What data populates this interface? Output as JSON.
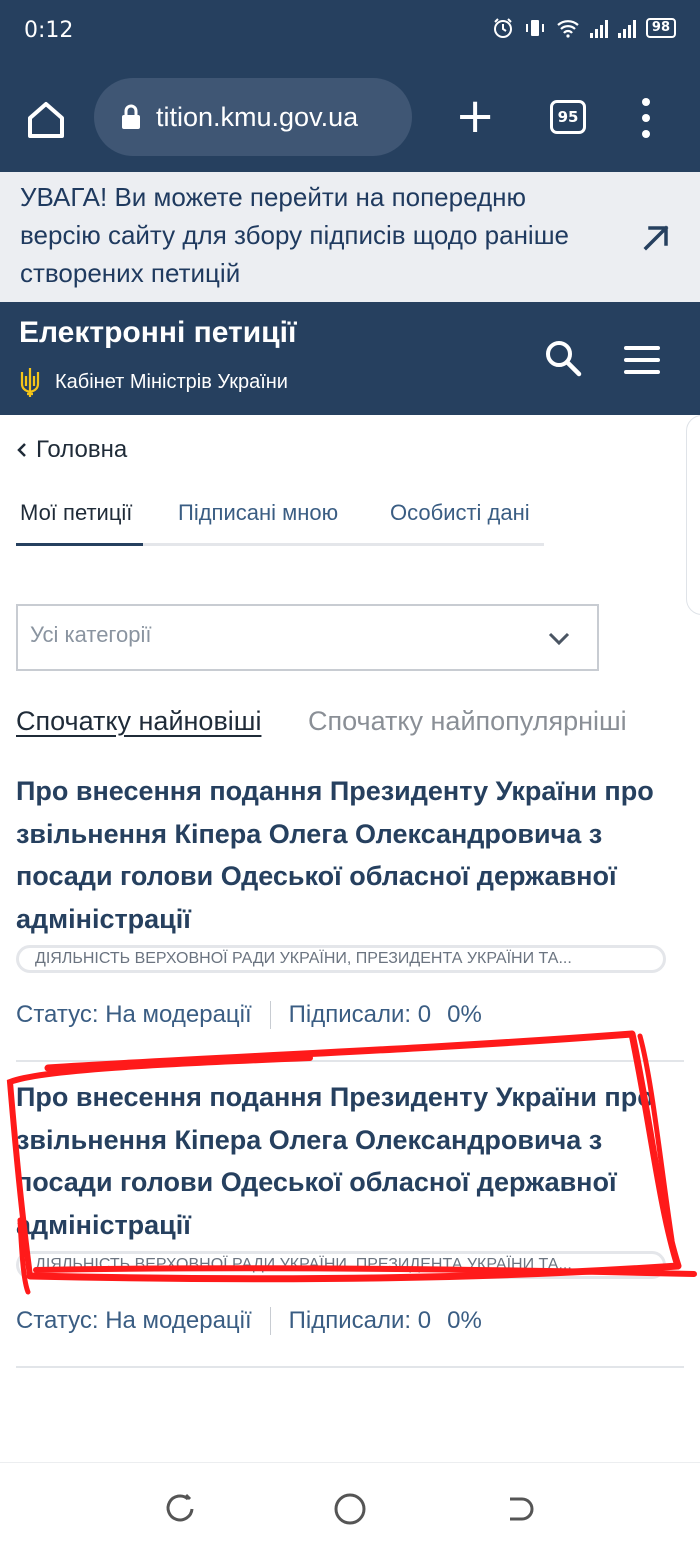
{
  "status_bar": {
    "time": "0:12",
    "battery": "98"
  },
  "browser": {
    "url": "tition.kmu.gov.ua",
    "tab_count": "95"
  },
  "notice": {
    "text": "УВАГА! Ви можете перейти на попередню версію сайту для збору підписів щодо раніше створених петицій"
  },
  "site_header": {
    "title": "Електронні петиції",
    "subtitle": "Кабінет Міністрів України"
  },
  "breadcrumb": {
    "label": "Головна"
  },
  "tabs": [
    {
      "label": "Мої петиції",
      "active": true
    },
    {
      "label": "Підписані мною",
      "active": false
    },
    {
      "label": "Особисті дані",
      "active": false
    }
  ],
  "filter": {
    "category_value": "Усі категорії"
  },
  "sort": {
    "newest": "Спочатку найновіші",
    "popular": "Спочатку найпопулярніші"
  },
  "petitions": [
    {
      "title": "Про внесення подання Президенту України про звільнення Кіпера Олега Олександровича з посади голови Одеської обласної державної адміністрації",
      "category": "ДІЯЛЬНІСТЬ ВЕРХОВНОЇ РАДИ УКРАЇНИ, ПРЕЗИДЕНТА УКРАЇНИ ТА...",
      "status": "Статус: На модерації",
      "signed": "Підписали: 0",
      "percent": "0%"
    },
    {
      "title": "Про внесення подання Президенту України про звільнення Кіпера Олега Олександровича з посади голови Одеської обласної державної адміністрації",
      "category": "ДІЯЛЬНІСТЬ ВЕРХОВНОЇ РАДИ УКРАЇНИ, ПРЕЗИДЕНТА УКРАЇНИ ТА...",
      "status": "Статус: На модерації",
      "signed": "Підписали: 0",
      "percent": "0%"
    }
  ],
  "colors": {
    "header_bg": "#26405f",
    "accent_text": "#26405f",
    "annotation": "#ff1a1a"
  }
}
